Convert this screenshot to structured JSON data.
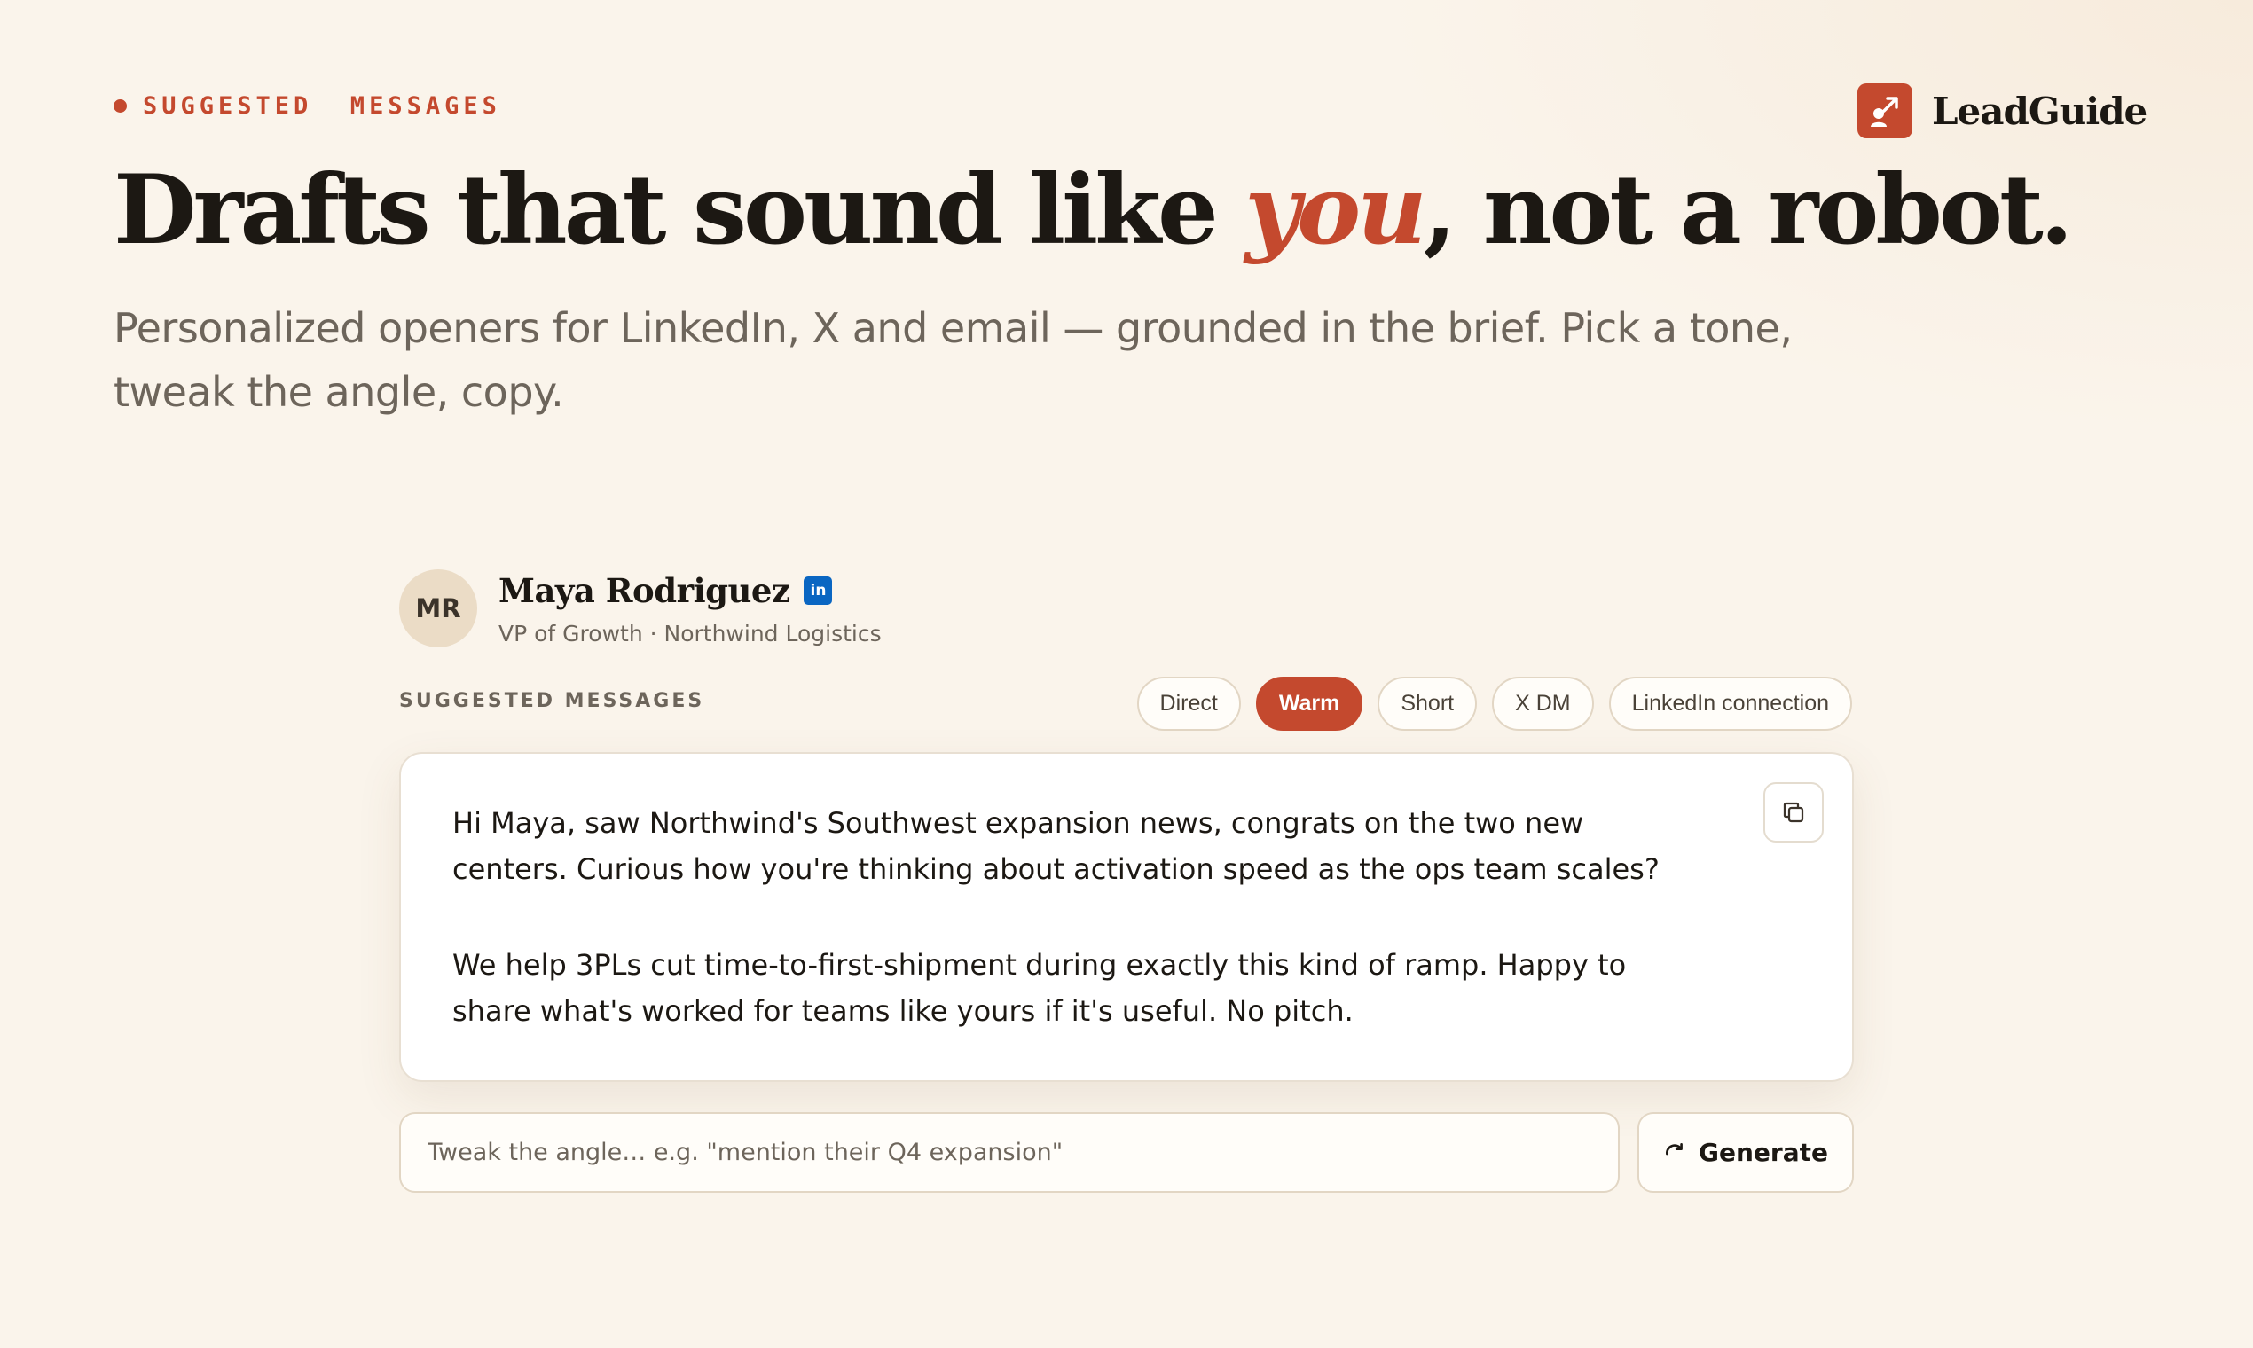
{
  "eyebrow": {
    "label": "SUGGESTED  MESSAGES"
  },
  "brand": {
    "name": "LeadGuide",
    "icon": "arrow-up-right-person-icon",
    "color": "#c4492e"
  },
  "hero": {
    "headline_pre": "Drafts that sound like ",
    "headline_accent": "you",
    "headline_post": ", not a robot.",
    "subhead": "Personalized openers for LinkedIn, X and email — grounded in the brief. Pick a tone, tweak the angle, copy."
  },
  "profile": {
    "initials": "MR",
    "name": "Maya Rodriguez",
    "network_badge": "in",
    "title": "VP of Growth · Northwind Logistics"
  },
  "messages": {
    "section_label": "SUGGESTED MESSAGES",
    "tones": [
      {
        "label": "Direct",
        "active": false
      },
      {
        "label": "Warm",
        "active": true
      },
      {
        "label": "Short",
        "active": false
      },
      {
        "label": "X DM",
        "active": false
      },
      {
        "label": "LinkedIn connection",
        "active": false
      }
    ],
    "draft_paragraphs": [
      "Hi Maya, saw Northwind's Southwest expansion news, congrats on the two new centers. Curious how you're thinking about activation speed as the ops team scales?",
      "We help 3PLs cut time-to-first-shipment during exactly this kind of ramp. Happy to share what's worked for teams like yours if it's useful. No pitch."
    ],
    "copy_icon": "copy-icon"
  },
  "tweak": {
    "placeholder": "Tweak the angle… e.g. \"mention their Q4 expansion\"",
    "value": "",
    "generate_label": "Generate",
    "generate_icon": "refresh-icon"
  }
}
